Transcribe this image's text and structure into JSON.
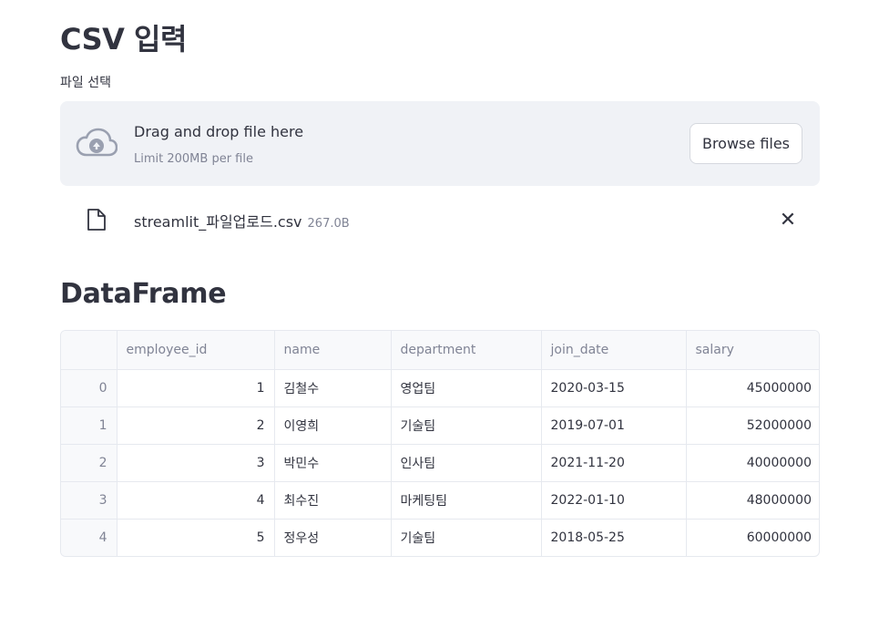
{
  "header": {
    "title": "CSV 입력"
  },
  "uploader": {
    "label": "파일 선택",
    "drag_text": "Drag and drop file here",
    "limit_text": "Limit 200MB per file",
    "browse_label": "Browse files",
    "icons": {
      "upload": "cloud-upload-icon",
      "file": "file-icon",
      "remove": "close-icon"
    }
  },
  "uploaded_file": {
    "name": "streamlit_파일업로드.csv",
    "size": "267.0B"
  },
  "section": {
    "title": "DataFrame"
  },
  "dataframe": {
    "columns": [
      "",
      "employee_id",
      "name",
      "department",
      "join_date",
      "salary"
    ],
    "rows": [
      {
        "index": "0",
        "employee_id": "1",
        "name": "김철수",
        "department": "영업팀",
        "join_date": "2020-03-15",
        "salary": "45000000"
      },
      {
        "index": "1",
        "employee_id": "2",
        "name": "이영희",
        "department": "기술팀",
        "join_date": "2019-07-01",
        "salary": "52000000"
      },
      {
        "index": "2",
        "employee_id": "3",
        "name": "박민수",
        "department": "인사팀",
        "join_date": "2021-11-20",
        "salary": "40000000"
      },
      {
        "index": "3",
        "employee_id": "4",
        "name": "최수진",
        "department": "마케팅팀",
        "join_date": "2022-01-10",
        "salary": "48000000"
      },
      {
        "index": "4",
        "employee_id": "5",
        "name": "정우성",
        "department": "기술팀",
        "join_date": "2018-05-25",
        "salary": "60000000"
      }
    ]
  },
  "colors": {
    "text": "#31333f",
    "muted": "#808495",
    "dropzone_bg": "#f0f2f6",
    "border": "#e6e9ef"
  }
}
